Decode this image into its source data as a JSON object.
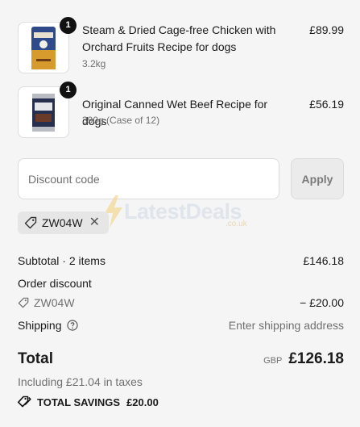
{
  "order_items": [
    {
      "title": "Steam & Dried Cage-free Chicken with Orchard Fruits Recipe for dogs",
      "variant": "3.2kg",
      "price": "£89.99",
      "quantity": "1",
      "image": "dog-food-bag-image"
    },
    {
      "title": "Original Canned Wet Beef Recipe for dogs",
      "variant": "390g (Case of 12)",
      "price": "£56.19",
      "quantity": "1",
      "image": "dog-food-can-image"
    }
  ],
  "discount": {
    "placeholder": "Discount code",
    "apply_label": "Apply",
    "applied_code": "ZW04W"
  },
  "watermark": {
    "text": "LatestDeals",
    "sub": ".co.uk"
  },
  "summary": {
    "subtotal_label": "Subtotal · 2 items",
    "subtotal_value": "£146.18",
    "order_discount_label": "Order discount",
    "discount_code": "ZW04W",
    "discount_value": "− £20.00",
    "shipping_label": "Shipping",
    "shipping_value": "Enter shipping address",
    "total_label": "Total",
    "total_currency": "GBP",
    "total_value": "£126.18",
    "taxes_text": "Including £21.04 in taxes",
    "savings_label": "TOTAL SAVINGS",
    "savings_value": "£20.00"
  },
  "colors": {
    "background": "#f5f5f5",
    "text": "#1a1a1a",
    "muted": "#707070"
  }
}
